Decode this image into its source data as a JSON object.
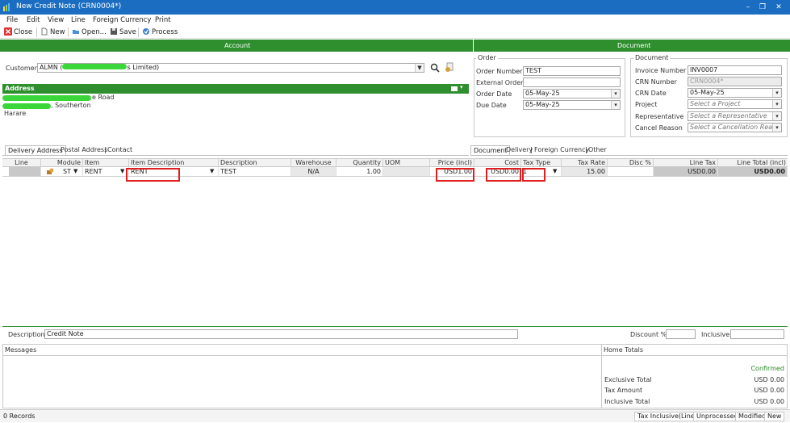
{
  "window": {
    "title": "New Credit Note (CRN0004*)",
    "minimize": "–",
    "restore": "❐",
    "close": "✕"
  },
  "menu": [
    "File",
    "Edit",
    "View",
    "Line",
    "Foreign Currency",
    "Print"
  ],
  "toolbar": {
    "close": "Close",
    "new": "New",
    "open": "Open...",
    "save": "Save",
    "process": "Process"
  },
  "sections": {
    "account": "Account",
    "document": "Document"
  },
  "customer": {
    "label": "Customer",
    "code": "ALMN (",
    "name_suffix": "s Limited)"
  },
  "address": {
    "title": "Address",
    "line1_suffix": "e Road",
    "line2_suffix": ", Southerton",
    "line3": "Harare"
  },
  "order": {
    "title": "Order",
    "order_number_label": "Order Number",
    "order_number": "TEST",
    "external_order_label": "External Order",
    "external_order": "",
    "order_date_label": "Order Date",
    "order_date": "05-May-25",
    "due_date_label": "Due Date",
    "due_date": "05-May-25"
  },
  "document": {
    "title": "Document",
    "invoice_number_label": "Invoice Number",
    "invoice_number": "INV0007",
    "crn_number_label": "CRN Number",
    "crn_number": "CRN0004*",
    "crn_date_label": "CRN Date",
    "crn_date": "05-May-25",
    "project_label": "Project",
    "project_placeholder": "Select a Project",
    "representative_label": "Representative",
    "representative_placeholder": "Select a Representative",
    "cancel_reason_label": "Cancel Reason",
    "cancel_reason_placeholder": "Select a Cancellation Reason"
  },
  "left_tabs": [
    "Delivery Address",
    "Postal Address",
    "Contact"
  ],
  "right_tabs": [
    "Document",
    "Delivery",
    "Foreign Currency",
    "Other"
  ],
  "grid": {
    "headers": {
      "line": "Line",
      "module": "Module",
      "item": "Item",
      "item_description": "Item Description",
      "description": "Description",
      "warehouse": "Warehouse",
      "quantity": "Quantity",
      "uom": "UOM",
      "price": "Price (incl)",
      "cost": "Cost",
      "tax_type": "Tax Type",
      "tax_rate": "Tax Rate",
      "disc": "Disc %",
      "line_tax": "Line Tax",
      "line_total": "Line Total (incl)"
    },
    "row": {
      "module": "ST",
      "item": "RENT",
      "item_description": "RENT",
      "description": "TEST",
      "warehouse": "N/A",
      "quantity": "1.00",
      "uom": "",
      "price": "USD1.00",
      "cost": "USD0.00",
      "tax_type": "1",
      "tax_rate": "15.00",
      "disc": "",
      "line_tax": "USD0.00",
      "line_total": "USD0.00"
    }
  },
  "footer": {
    "description_label": "Description",
    "description": "Credit Note",
    "discount_label": "Discount %",
    "discount": "",
    "inclusive_label": "Inclusive",
    "inclusive": "",
    "messages_label": "Messages",
    "home_totals_label": "Home Totals",
    "status": "Confirmed",
    "exclusive_total_label": "Exclusive Total",
    "exclusive_total": "USD 0.00",
    "tax_amount_label": "Tax Amount",
    "tax_amount": "USD 0.00",
    "inclusive_total_label": "Inclusive Total",
    "inclusive_total": "USD 0.00"
  },
  "statusbar": {
    "records": "0 Records",
    "tax_mode": "Tax Inclusive(Line)",
    "process_state": "Unprocessed",
    "edit_state": "Modified",
    "doc_state": "New"
  },
  "colors": {
    "titlebar": "#1b6dc1",
    "section_green": "#2f8f2f",
    "redaction_green": "#3ad63a",
    "highlight_red": "#e02020"
  }
}
